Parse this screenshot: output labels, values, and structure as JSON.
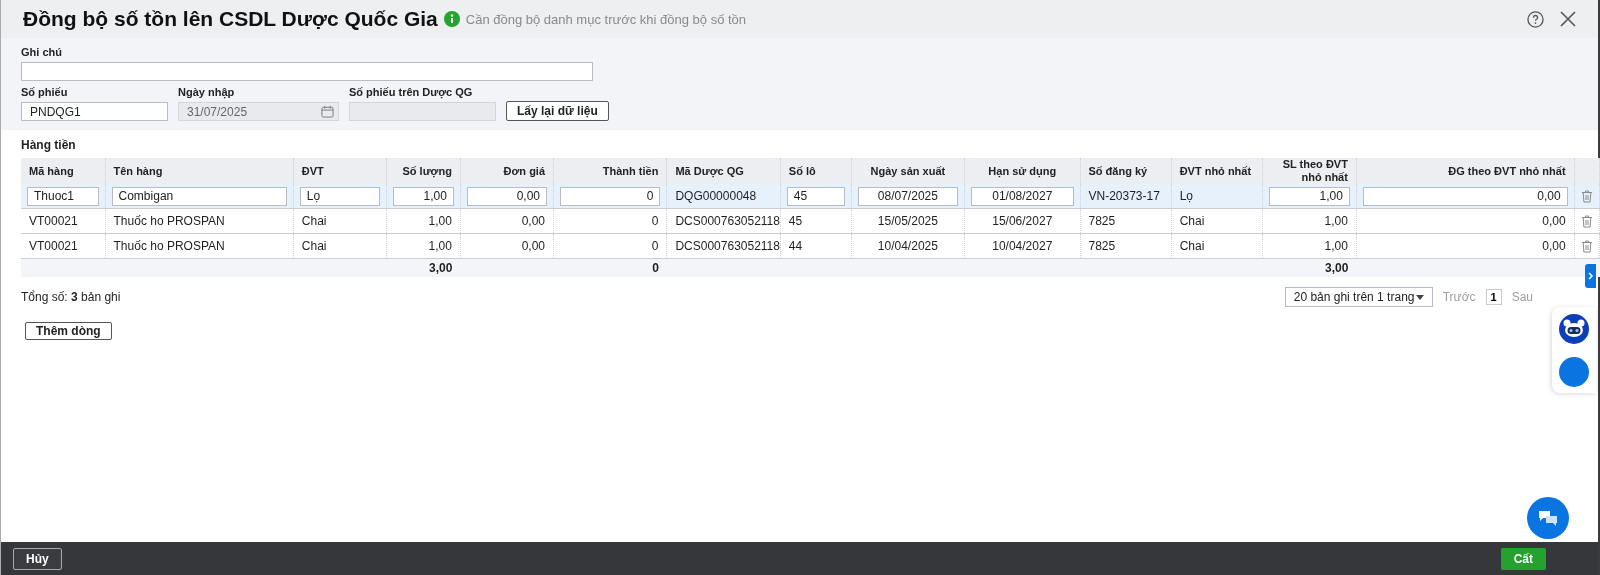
{
  "header": {
    "title": "Đồng bộ số tồn lên CSDL Dược Quốc Gia",
    "hint": "Cần đồng bộ danh mục trước khi đồng bộ số tồn"
  },
  "form": {
    "note": {
      "label": "Ghi chú"
    },
    "voucher": {
      "label": "Số phiếu",
      "value": "PNDQG1",
      "disabled": false
    },
    "date": {
      "label": "Ngày nhập",
      "value": "31/07/2025",
      "disabled": true
    },
    "national_voucher": {
      "label": "Số phiếu trên Dược QG",
      "disabled": true
    },
    "reload_button": "Lấy lại dữ liệu"
  },
  "section_title": "Hàng tiền",
  "table": {
    "columns": [
      {
        "label": "Mã hàng",
        "kind": "text",
        "editable": true
      },
      {
        "label": "Tên hàng",
        "kind": "text",
        "editable": true
      },
      {
        "label": "ĐVT",
        "kind": "text",
        "editable": true
      },
      {
        "label": "Số lượng",
        "kind": "number",
        "editable": true,
        "total": "3,00"
      },
      {
        "label": "Đơn giá",
        "kind": "number",
        "editable": true
      },
      {
        "label": "Thành tiền",
        "kind": "number",
        "editable": true,
        "total": "0"
      },
      {
        "label": "Mã Dược QG",
        "kind": "text",
        "editable": false
      },
      {
        "label": "Số lô",
        "kind": "text",
        "editable": true
      },
      {
        "label": "Ngày sản xuất",
        "kind": "date",
        "editable": true
      },
      {
        "label": "Hạn sử dụng",
        "kind": "date",
        "editable": true
      },
      {
        "label": "Số đăng ký",
        "kind": "text",
        "editable": false
      },
      {
        "label": "ĐVT nhỏ nhất",
        "kind": "text",
        "editable": false
      },
      {
        "label": "SL theo ĐVT nhỏ nhất",
        "kind": "number",
        "editable": true,
        "total": "3,00"
      },
      {
        "label": "ĐG theo ĐVT nhỏ nhất",
        "kind": "number",
        "editable": true
      }
    ],
    "rows": [
      {
        "selected": true,
        "editing": true,
        "cells": [
          "Thuoc1",
          "Combigan",
          "Lọ",
          "1,00",
          "0,00",
          "0",
          "DQG00000048",
          "45",
          "08/07/2025",
          "01/08/2027",
          "VN-20373-17",
          "Lọ",
          "1,00",
          "0,00"
        ]
      },
      {
        "selected": false,
        "editing": false,
        "cells": [
          "VT00021",
          "Thuốc ho PROSPAN",
          "Chai",
          "1,00",
          "0,00",
          "0",
          "DCS000763052118",
          "45",
          "15/05/2025",
          "15/06/2027",
          "7825",
          "Chai",
          "1,00",
          "0,00"
        ]
      },
      {
        "selected": false,
        "editing": false,
        "cells": [
          "VT00021",
          "Thuốc ho PROSPAN",
          "Chai",
          "1,00",
          "0,00",
          "0",
          "DCS000763052118",
          "44",
          "10/04/2025",
          "10/04/2027",
          "7825",
          "Chai",
          "1,00",
          "0,00"
        ]
      }
    ]
  },
  "summary": "Tổng số: **3** bản ghi",
  "pagination": {
    "page_size": "20 bản ghi trên 1 trang",
    "prev": {
      "label": "Trước",
      "disabled": true
    },
    "page": "1",
    "next": {
      "label": "Sau",
      "disabled": true
    }
  },
  "add_row_button": "Thêm dòng",
  "footer": {
    "cancel_button": "Hủy",
    "save_button": "Cất"
  }
}
